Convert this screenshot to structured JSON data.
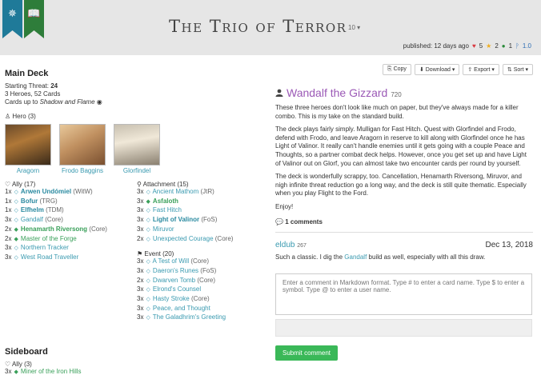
{
  "header": {
    "title": "The Trio of Terror",
    "version": "10",
    "published": "published: 12 days ago",
    "likes": "5",
    "favorites": "2",
    "comments": "1",
    "deck_version": "1.0"
  },
  "deck": {
    "heading": "Main Deck",
    "threat_label": "Starting Threat:",
    "threat": "24",
    "summary": "3 Heroes, 52 Cards",
    "cards_up_to": "Cards up to",
    "cards_up_to_set": "Shadow and Flame",
    "hero_heading": "Hero (3)",
    "heroes": [
      {
        "name": "Aragorn"
      },
      {
        "name": "Frodo Baggins"
      },
      {
        "name": "Glorfindel"
      }
    ],
    "ally_heading": "Ally (17)",
    "allies": [
      {
        "qty": "1x",
        "name": "Arwen Undómiel",
        "set": "(WitW)",
        "style": "b"
      },
      {
        "qty": "1x",
        "name": "Bofur",
        "set": "(TRG)",
        "style": "b"
      },
      {
        "qty": "1x",
        "name": "Elfhelm",
        "set": "(TDM)",
        "style": "b"
      },
      {
        "qty": "3x",
        "name": "Gandalf",
        "set": "(Core)",
        "style": "n"
      },
      {
        "qty": "2x",
        "name": "Henamarth Riversong",
        "set": "(Core)",
        "style": "gb"
      },
      {
        "qty": "2x",
        "name": "Master of the Forge",
        "set": "",
        "style": "g"
      },
      {
        "qty": "3x",
        "name": "Northern Tracker",
        "set": "",
        "style": ""
      },
      {
        "qty": "3x",
        "name": "West Road Traveller",
        "set": "",
        "style": ""
      }
    ],
    "attachment_heading": "Attachment (15)",
    "attachments": [
      {
        "qty": "3x",
        "name": "Ancient Mathom",
        "set": "(JtR)",
        "style": ""
      },
      {
        "qty": "3x",
        "name": "Asfaloth",
        "set": "",
        "style": "gb"
      },
      {
        "qty": "3x",
        "name": "Fast Hitch",
        "set": "",
        "style": ""
      },
      {
        "qty": "3x",
        "name": "Light of Valinor",
        "set": "(FoS)",
        "style": "b"
      },
      {
        "qty": "3x",
        "name": "Miruvor",
        "set": "",
        "style": ""
      },
      {
        "qty": "2x",
        "name": "Unexpected Courage",
        "set": "(Core)",
        "style": ""
      }
    ],
    "event_heading": "Event (20)",
    "events": [
      {
        "qty": "3x",
        "name": "A Test of Will",
        "set": "(Core)",
        "style": ""
      },
      {
        "qty": "3x",
        "name": "Daeron's Runes",
        "set": "(FoS)",
        "style": ""
      },
      {
        "qty": "2x",
        "name": "Dwarven Tomb",
        "set": "(Core)",
        "style": ""
      },
      {
        "qty": "3x",
        "name": "Elrond's Counsel",
        "set": "",
        "style": ""
      },
      {
        "qty": "3x",
        "name": "Hasty Stroke",
        "set": "(Core)",
        "style": ""
      },
      {
        "qty": "3x",
        "name": "Peace, and Thought",
        "set": "",
        "style": ""
      },
      {
        "qty": "3x",
        "name": "The Galadhrim's Greeting",
        "set": "",
        "style": ""
      }
    ]
  },
  "sideboard": {
    "heading": "Sideboard",
    "ally_heading": "Ally (3)",
    "row_qty": "3x",
    "row_name": "Miner of the Iron Hills"
  },
  "toolbar": {
    "copy": "Copy",
    "download": "Download",
    "export": "Export",
    "sort": "Sort"
  },
  "author": {
    "name": "Wandalf the Gizzard",
    "reputation": "720"
  },
  "description": [
    "These three heroes don't look like much on paper, but they've always made for a killer combo. This is my take on the standard build.",
    "The deck plays fairly simply. Mulligan for Fast Hitch. Quest with Glorfindel and Frodo, defend with Frodo, and leave Aragorn in reserve to kill along with Glorfindel once he has Light of Valinor. It really can't handle enemies until it gets going with a couple Peace and Thoughts, so a partner combat deck helps. However, once you get set up and have Light of Valinor out on Glorf, you can almost take two encounter cards per round by yourself.",
    "The deck is wonderfully scrappy, too. Cancellation, Henamarth Riversong, Miruvor, and nigh infinite threat reduction go a long way, and the deck is still quite thematic. Especially when you play Flight to the Ford.",
    "Enjoy!"
  ],
  "comments": {
    "heading": "1 comments",
    "items": [
      {
        "user": "eldub",
        "rep": "267",
        "date": "Dec 13, 2018",
        "text_before": "Such a classic. I dig the",
        "link": "Gandalf",
        "text_after": "build as well, especially with all this draw."
      }
    ],
    "placeholder": "Enter a comment in Markdown format. Type # to enter a card name. Type $ to enter a symbol. Type @ to enter a user name.",
    "submit": "Submit comment"
  },
  "colors": {
    "accent": "#3a9ab0",
    "author": "#9b59b6",
    "submit": "#3ab858",
    "ribbon_blue": "#1f7a99",
    "ribbon_green": "#2e7d3a"
  }
}
